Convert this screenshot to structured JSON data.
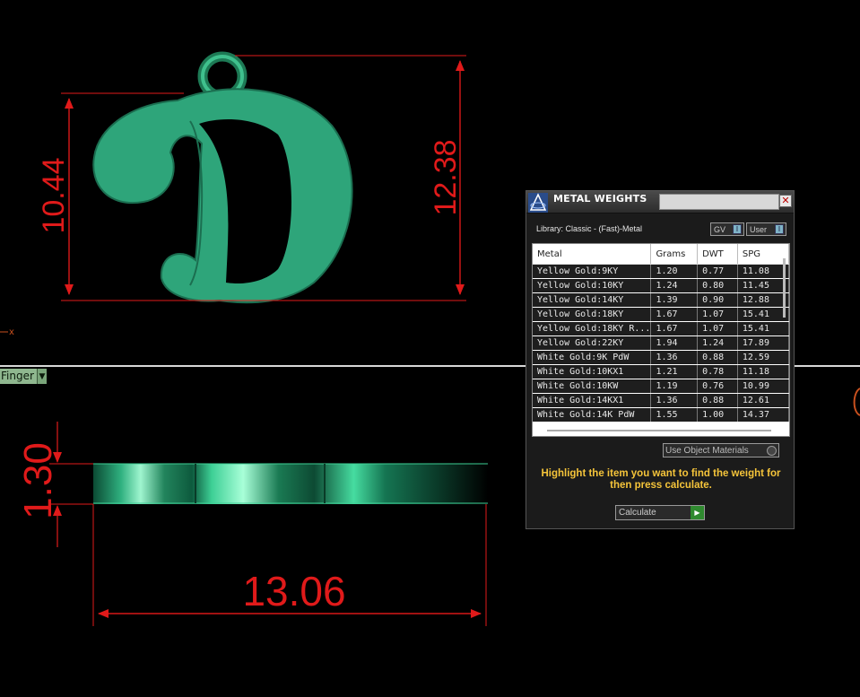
{
  "dimensions": {
    "top_view_height": "10.44",
    "top_view_total_height": "12.38",
    "side_thickness": "1.30",
    "side_width": "13.06"
  },
  "axis_marker": "x",
  "view_selector": {
    "label": "Finger"
  },
  "metal_weights": {
    "title": "METAL WEIGHTS",
    "library": "Library: Classic - (Fast)-Metal",
    "toggles": {
      "gv": "GV",
      "user": "User"
    },
    "columns": [
      "Metal",
      "Grams",
      "DWT",
      "SPG"
    ],
    "rows": [
      [
        "Yellow Gold:9KY",
        "1.20",
        "0.77",
        "11.08"
      ],
      [
        "Yellow Gold:10KY",
        "1.24",
        "0.80",
        "11.45"
      ],
      [
        "Yellow Gold:14KY",
        "1.39",
        "0.90",
        "12.88"
      ],
      [
        "Yellow Gold:18KY",
        "1.67",
        "1.07",
        "15.41"
      ],
      [
        "Yellow Gold:18KY R...",
        "1.67",
        "1.07",
        "15.41"
      ],
      [
        "Yellow Gold:22KY",
        "1.94",
        "1.24",
        "17.89"
      ],
      [
        "White Gold:9K PdW",
        "1.36",
        "0.88",
        "12.59"
      ],
      [
        "White Gold:10KX1",
        "1.21",
        "0.78",
        "11.18"
      ],
      [
        "White Gold:10KW",
        "1.19",
        "0.76",
        "10.99"
      ],
      [
        "White Gold:14KX1",
        "1.36",
        "0.88",
        "12.61"
      ],
      [
        "White Gold:14K PdW",
        "1.55",
        "1.00",
        "14.37"
      ]
    ],
    "use_object_materials": "Use Object Materials",
    "instruction": "Highlight the item you want to find the weight for then press calculate.",
    "calculate": "Calculate"
  },
  "colors": {
    "dimension": "#e01a1a",
    "model": "#2ea57a",
    "instruction": "#f5c43a"
  }
}
